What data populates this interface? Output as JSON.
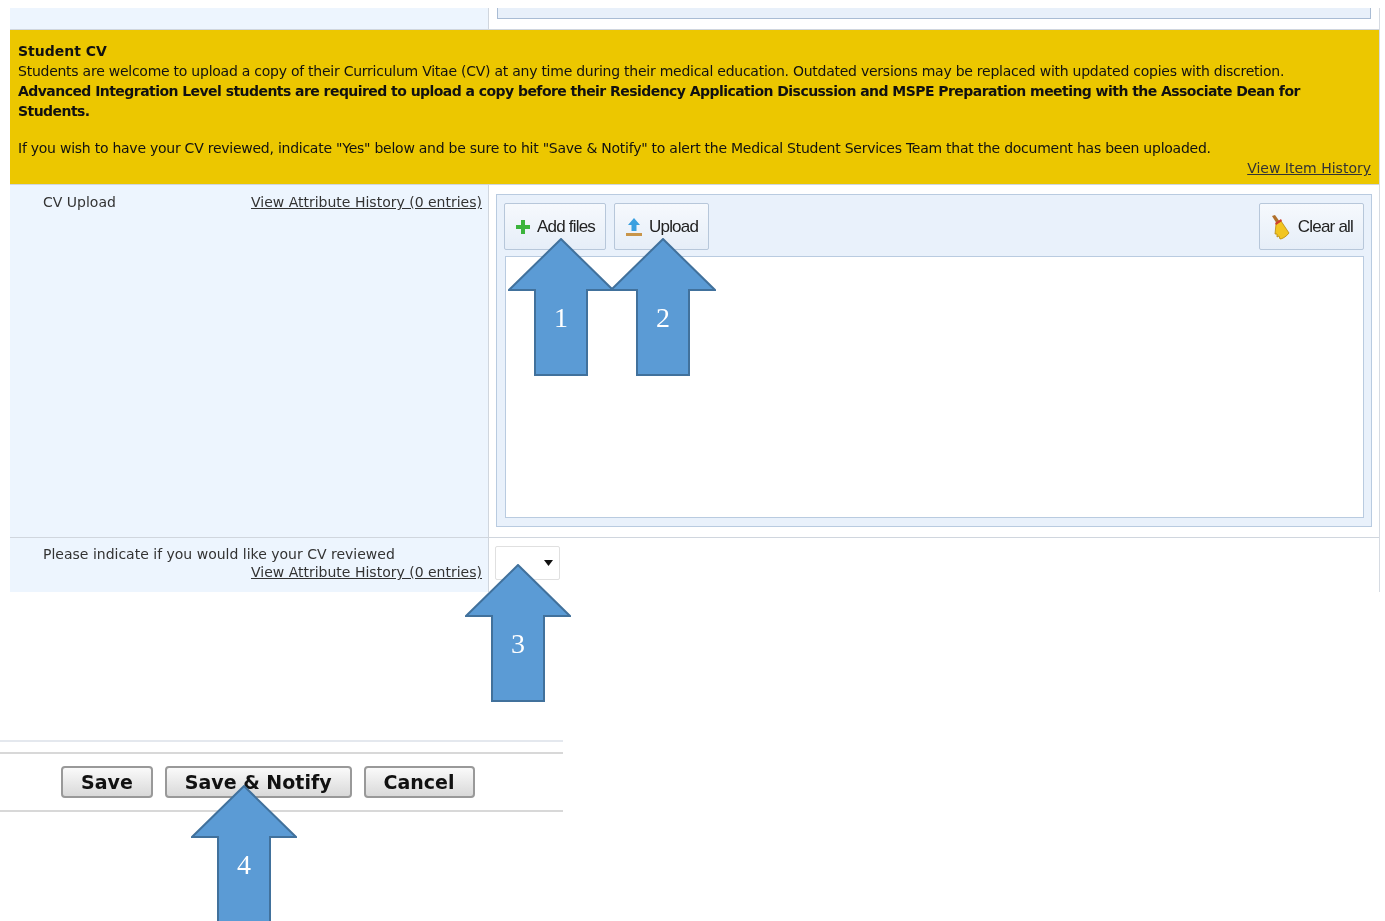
{
  "banner": {
    "title": "Student CV",
    "intro": "Students are welcome to upload a copy of their Curriculum Vitae (CV) at any time during their medical education. Outdated versions may be replaced with updated copies with discretion.",
    "requirement": "Advanced Integration Level students are required to upload a copy before their Residency Application Discussion and MSPE Preparation meeting with the Associate Dean for Students.",
    "instruction": "If you wish to have your CV reviewed, indicate \"Yes\" below and be sure to hit \"Save & Notify\" to alert the Medical Student Services Team that the document has been uploaded.",
    "history_link": "View Item History"
  },
  "fields": [
    {
      "kind": "upload",
      "label": "CV Upload",
      "history_link": "View Attribute History (0 entries)",
      "buttons": [
        {
          "kind": "add",
          "label": "Add files"
        },
        {
          "kind": "upload",
          "label": "Upload"
        },
        {
          "kind": "clear",
          "label": "Clear all"
        }
      ]
    },
    {
      "kind": "select",
      "label": "Please indicate if you would like your CV reviewed",
      "history_link": "View Attribute History (0 entries)"
    }
  ],
  "actions": [
    "Save",
    "Save & Notify",
    "Cancel"
  ],
  "callouts": [
    {
      "label": "1"
    },
    {
      "label": "2"
    },
    {
      "label": "3"
    },
    {
      "label": "4"
    }
  ]
}
